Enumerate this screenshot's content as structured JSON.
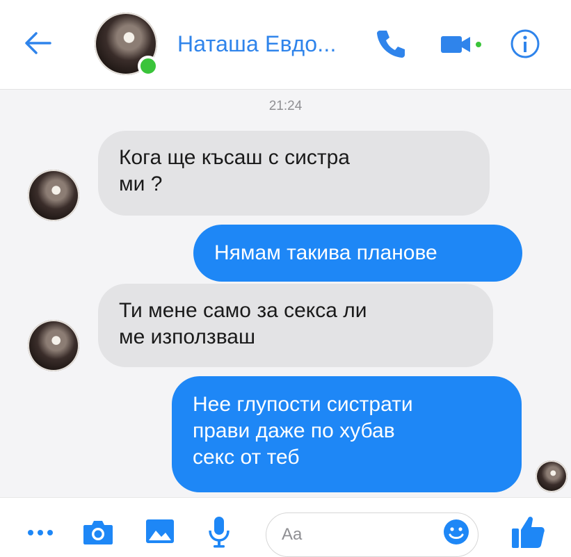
{
  "header": {
    "contact_name": "Наташа Евдо...",
    "icons": {
      "back": "arrow-left-icon",
      "call": "phone-icon",
      "video": "video-camera-icon",
      "info": "info-icon"
    }
  },
  "chat": {
    "timestamp": "21:24",
    "messages": [
      {
        "direction": "incoming",
        "text": "Кога ще късаш с систра\nми ?"
      },
      {
        "direction": "outgoing",
        "text": "Нямам такива планове"
      },
      {
        "direction": "incoming",
        "text": "Ти мене само за секса ли\nме използваш"
      },
      {
        "direction": "outgoing",
        "text": "Нее глупости систрати\nправи даже по хубав\nсекс от теб"
      }
    ]
  },
  "composer": {
    "placeholder": "Aa",
    "icons": [
      "more-icon",
      "camera-icon",
      "image-icon",
      "microphone-icon",
      "emoji-icon",
      "thumbs-up-icon"
    ]
  },
  "colors": {
    "accent": "#1e87f6",
    "header_text": "#2f84eb",
    "incoming_bubble": "#e3e3e5",
    "online": "#3ac43a"
  }
}
